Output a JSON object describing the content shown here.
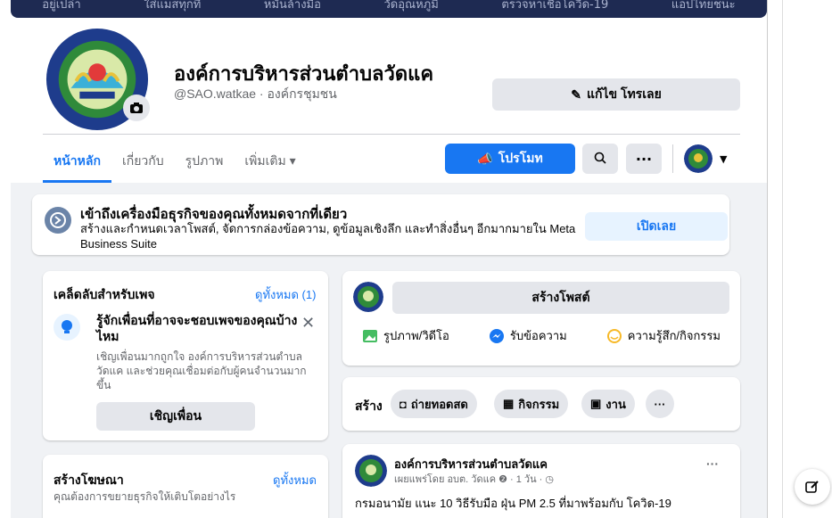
{
  "cover": {
    "items": [
      "อยู่เปล่า",
      "ใส่แมสทุกที่",
      "หมั่นล้างมือ",
      "วัดอุณหภูมิ",
      "ตรวจหาเชื้อโควิด-19",
      "แอปไทยชนะ"
    ]
  },
  "page": {
    "name": "องค์การบริหารส่วนตำบลวัดแค",
    "handle": "@SAO.watkae · องค์กรชุมชน",
    "edit_label": "แก้ไข โทรเลย"
  },
  "nav": {
    "tabs": [
      "หน้าหลัก",
      "เกี่ยวกับ",
      "รูปภาพ",
      "เพิ่มเติม ▾"
    ],
    "promote_label": "โปรโมท"
  },
  "suite": {
    "title": "เข้าถึงเครื่องมือธุรกิจของคุณทั้งหมดจากที่เดียว",
    "desc": "สร้างและกำหนดเวลาโพสต์, จัดการกล่องข้อความ, ดูข้อมูลเชิงลึก และทำสิ่งอื่นๆ อีกมากมายใน Meta Business Suite",
    "button": "เปิดเลย"
  },
  "tips": {
    "title": "เคล็ดลับสำหรับเพจ",
    "see_all": "ดูทั้งหมด (1)",
    "tip_title": "รู้จักเพื่อนที่อาจจะชอบเพจของคุณบ้างไหม",
    "tip_desc": "เชิญเพื่อนมากถูกใจ องค์การบริหารส่วนตำบลวัดแค และช่วยคุณเชื่อมต่อกับผู้คนจำนวนมากขึ้น",
    "invite_label": "เชิญเพื่อน"
  },
  "ads": {
    "title": "สร้างโฆษณา",
    "see_all": "ดูทั้งหมด",
    "desc": "คุณต้องการขยายธุรกิจให้เติบโตอย่างไร"
  },
  "create": {
    "button": "สร้างโพสต์",
    "photo": "รูปภาพ/วิดีโอ",
    "message": "รับข้อความ",
    "feeling": "ความรู้สึก/กิจกรรม"
  },
  "shortcuts": {
    "label": "สร้าง",
    "live": "ถ่ายทอดสด",
    "event": "กิจกรรม",
    "job": "งาน",
    "more": "···"
  },
  "post": {
    "author": "องค์การบริหารส่วนตำบลวัดแค",
    "meta": "เผยแพร่โดย อบต. วัดแค ❷ · 1 วัน · ◷",
    "text": "กรมอนามัย แนะ 10 วิธีรับมือ ฝุ่น PM 2.5 ที่มาพร้อมกับ โควิด-19",
    "more": "···"
  }
}
